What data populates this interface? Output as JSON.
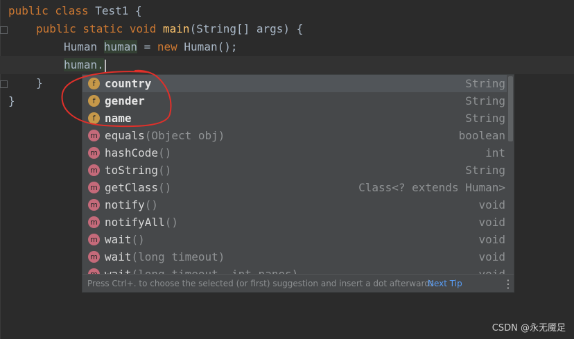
{
  "editor": {
    "lines": [
      {
        "kw1": "public class ",
        "name": "Test1",
        "rest": " {"
      },
      {
        "kw1": "public static void ",
        "fn": "main",
        "rest": "(String[] args) {"
      },
      {
        "t1": "Human ",
        "var": "human",
        "t2": " = ",
        "kw": "new",
        "t3": " Human();"
      },
      {
        "text": "human."
      },
      {
        "text": "}"
      },
      {
        "text": "}"
      }
    ]
  },
  "completion": {
    "items": [
      {
        "icon": "f",
        "kind": "field",
        "name": "country",
        "params": "",
        "type": "String",
        "selected": true
      },
      {
        "icon": "f",
        "kind": "field",
        "name": "gender",
        "params": "",
        "type": "String"
      },
      {
        "icon": "f",
        "kind": "field",
        "name": "name",
        "params": "",
        "type": "String"
      },
      {
        "icon": "m",
        "kind": "method",
        "name": "equals",
        "params": "(Object obj)",
        "type": "boolean"
      },
      {
        "icon": "m",
        "kind": "method",
        "name": "hashCode",
        "params": "()",
        "type": "int"
      },
      {
        "icon": "m",
        "kind": "method",
        "name": "toString",
        "params": "()",
        "type": "String"
      },
      {
        "icon": "m",
        "kind": "method",
        "name": "getClass",
        "params": "()",
        "type": "Class<? extends Human>"
      },
      {
        "icon": "m",
        "kind": "method",
        "name": "notify",
        "params": "()",
        "type": "void"
      },
      {
        "icon": "m",
        "kind": "method",
        "name": "notifyAll",
        "params": "()",
        "type": "void"
      },
      {
        "icon": "m",
        "kind": "method",
        "name": "wait",
        "params": "()",
        "type": "void"
      },
      {
        "icon": "m",
        "kind": "method",
        "name": "wait",
        "params": "(long timeout)",
        "type": "void"
      },
      {
        "icon": "m",
        "kind": "method",
        "name": "wait",
        "params": "(long timeout, int nanos)",
        "type": "void"
      }
    ],
    "footer_hint": "Press Ctrl+. to choose the selected (or first) suggestion and insert a dot afterwards",
    "next_tip": "Next Tip",
    "more_icon": "⋮"
  },
  "colors": {
    "annotation": "#e0302a",
    "field_icon": "#c69849",
    "method_icon": "#c56a7a"
  },
  "watermark": "CSDN @永无魇足"
}
